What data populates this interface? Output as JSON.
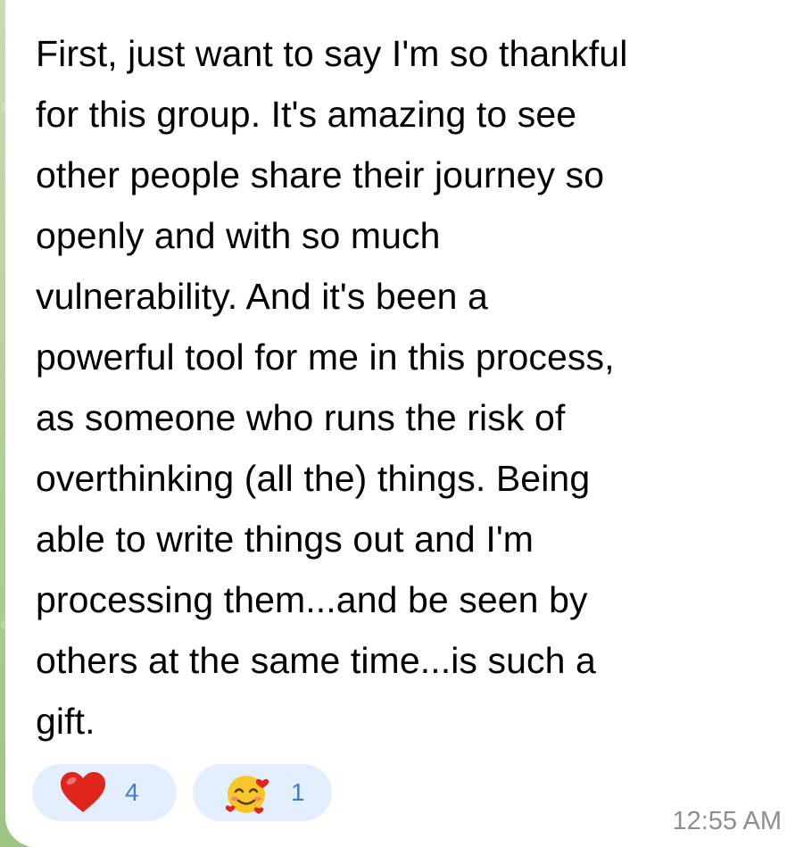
{
  "message": {
    "text": "First, just want to say I'm so thankful\nfor this group. It's amazing to see\nother people share their journey so\nopenly and with so much\nvulnerability. And it's been a\npowerful tool for me in this process,\nas someone who runs the risk of\noverthinking (all the) things. Being\nable to write things out and I'm\nprocessing them...and be seen by\nothers at the same time...is such a\ngift.",
    "time": "12:55 AM"
  },
  "reactions": [
    {
      "emoji": "red-heart-icon",
      "count": "4"
    },
    {
      "emoji": "smiling-face-with-hearts-icon",
      "count": "1"
    }
  ],
  "colors": {
    "bubble": "#ffffff",
    "reaction_pill": "#e4effd",
    "reaction_count": "#3a7fd6",
    "timestamp": "#8d8d93",
    "wallpaper": "#b9d3a3"
  }
}
